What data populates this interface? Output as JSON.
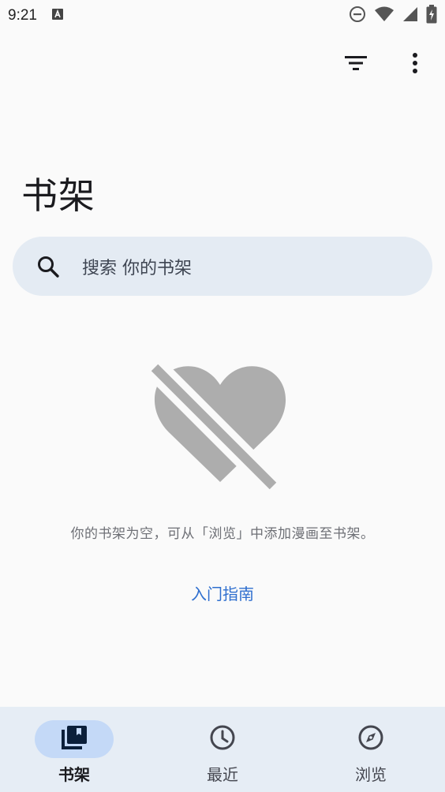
{
  "status_bar": {
    "time": "9:21",
    "icons": [
      "keyboard-a-icon",
      "do-not-disturb-icon",
      "wifi-icon",
      "signal-icon",
      "battery-charging-icon"
    ]
  },
  "toolbar": {
    "icons": [
      "filter-icon",
      "more-vert-icon"
    ]
  },
  "page": {
    "title": "书架"
  },
  "search": {
    "placeholder": "搜索 你的书架",
    "icon": "search-icon"
  },
  "empty_state": {
    "icon": "heart-off-icon",
    "message": "你的书架为空，可从「浏览」中添加漫画至书架。",
    "guide_link": "入门指南"
  },
  "bottom_nav": {
    "items": [
      {
        "label": "书架",
        "icon": "library-books-icon",
        "active": true
      },
      {
        "label": "最近",
        "icon": "history-clock-icon",
        "active": false
      },
      {
        "label": "浏览",
        "icon": "explore-compass-icon",
        "active": false
      }
    ]
  },
  "colors": {
    "background": "#fafafa",
    "search_bg": "#e4ebf3",
    "nav_bg": "#e6edf5",
    "nav_active_pill": "#c4d9f7",
    "link": "#2f6fcf",
    "empty_icon": "#adadad"
  }
}
